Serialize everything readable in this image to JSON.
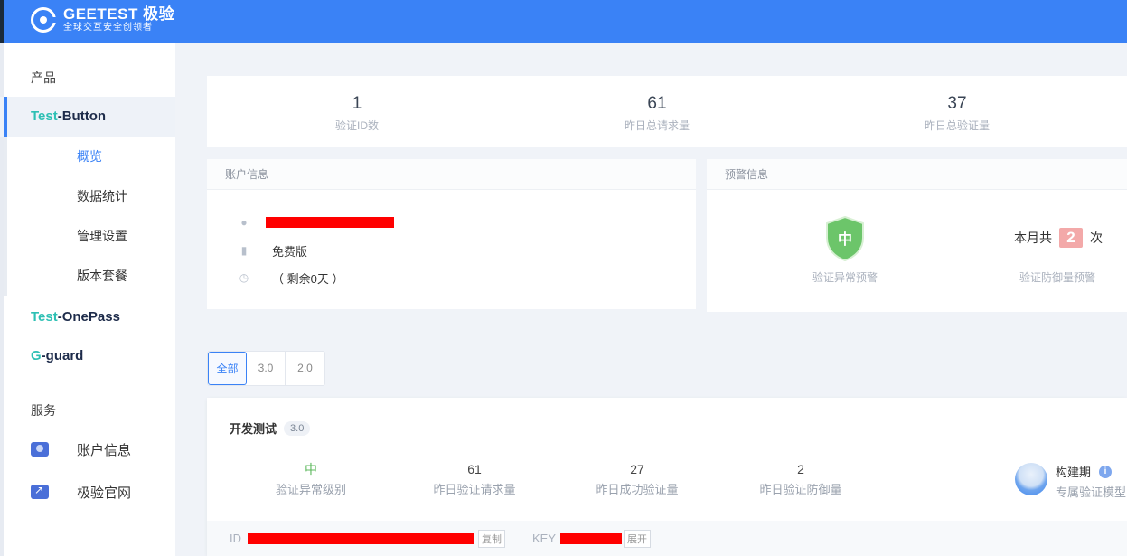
{
  "brand": {
    "name": "GEETEST 极验",
    "slogan": "全球交互安全创领者"
  },
  "sidebar": {
    "products_heading": "产品",
    "products": [
      {
        "prefix": "Test",
        "suffix": "-Button"
      },
      {
        "prefix": "Test",
        "suffix": "-OnePass"
      },
      {
        "prefix": "G",
        "suffix": "-guard"
      }
    ],
    "subnav": [
      "概览",
      "数据统计",
      "管理设置",
      "版本套餐"
    ],
    "services_heading": "服务",
    "services": [
      "账户信息",
      "极验官网"
    ]
  },
  "stats": [
    {
      "value": "1",
      "label": "验证ID数"
    },
    {
      "value": "61",
      "label": "昨日总请求量"
    },
    {
      "value": "37",
      "label": "昨日总验证量"
    }
  ],
  "account": {
    "heading": "账户信息",
    "plan": "免费版",
    "remaining": "（ 剩余0天 ）"
  },
  "warning": {
    "heading": "预警信息",
    "level": "中",
    "level_label": "验证异常预警",
    "month_prefix": "本月共",
    "month_count": "2",
    "month_suffix": "次",
    "defense_label": "验证防御量预警"
  },
  "filter": [
    "全部",
    "3.0",
    "2.0"
  ],
  "test_card": {
    "title": "开发测试",
    "version": "3.0",
    "metrics": [
      {
        "value": "中",
        "label": "验证异常级别"
      },
      {
        "value": "61",
        "label": "昨日验证请求量"
      },
      {
        "value": "27",
        "label": "昨日成功验证量"
      },
      {
        "value": "2",
        "label": "昨日验证防御量"
      }
    ],
    "model_title": "构建期",
    "model_sub": "专属验证模型",
    "id_label": "ID",
    "copy_label": "复制",
    "key_label": "KEY",
    "expand_label": "展开"
  },
  "colors": {
    "header": "#3a82f6",
    "accent": "#3a82f6",
    "product_prefix": "#2ec0b4",
    "shield": "#6cc56a",
    "badge": "#f3a9a9"
  }
}
